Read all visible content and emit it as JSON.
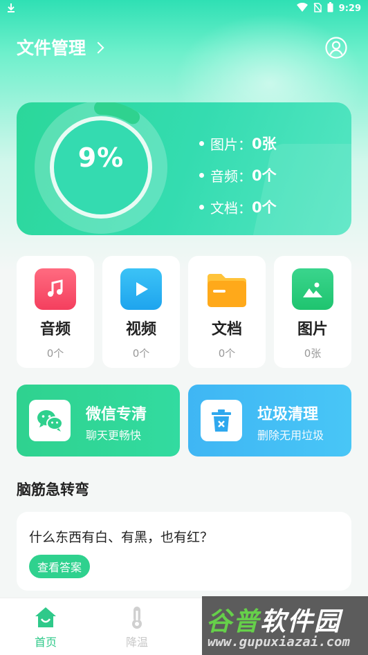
{
  "status_bar": {
    "time": "9:29"
  },
  "header": {
    "title": "文件管理"
  },
  "storage": {
    "percent": 9,
    "percent_label": "9%",
    "stats": [
      {
        "label": "图片：",
        "value": "0张"
      },
      {
        "label": "音频：",
        "value": "0个"
      },
      {
        "label": "文档：",
        "value": "0个"
      }
    ]
  },
  "categories": [
    {
      "name": "音频",
      "count": "0个",
      "icon": "music-icon",
      "color": "#f7506d"
    },
    {
      "name": "视频",
      "count": "0个",
      "icon": "play-icon",
      "color": "#27b3f2"
    },
    {
      "name": "文档",
      "count": "0个",
      "icon": "folder-icon",
      "color": "#ffb21f"
    },
    {
      "name": "图片",
      "count": "0张",
      "icon": "image-icon",
      "color": "#26cf7c"
    }
  ],
  "actions": [
    {
      "title": "微信专清",
      "subtitle": "聊天更畅快",
      "icon": "wechat-icon"
    },
    {
      "title": "垃圾清理",
      "subtitle": "删除无用垃圾",
      "icon": "trash-icon"
    }
  ],
  "riddle": {
    "section_title": "脑筋急转弯",
    "question": "什么东西有白、有黑，也有红？",
    "answer_button": "查看答案"
  },
  "nav": {
    "items": [
      {
        "label": "首页",
        "icon": "home-icon",
        "active": true
      },
      {
        "label": "降温",
        "icon": "thermometer-icon",
        "active": false
      }
    ]
  },
  "watermark": {
    "name_green": "谷普",
    "name_white": "软件园",
    "url": "www.gupuxiazai.com"
  },
  "colors": {
    "accent": "#2fc98a",
    "ring": "#ffffff"
  }
}
